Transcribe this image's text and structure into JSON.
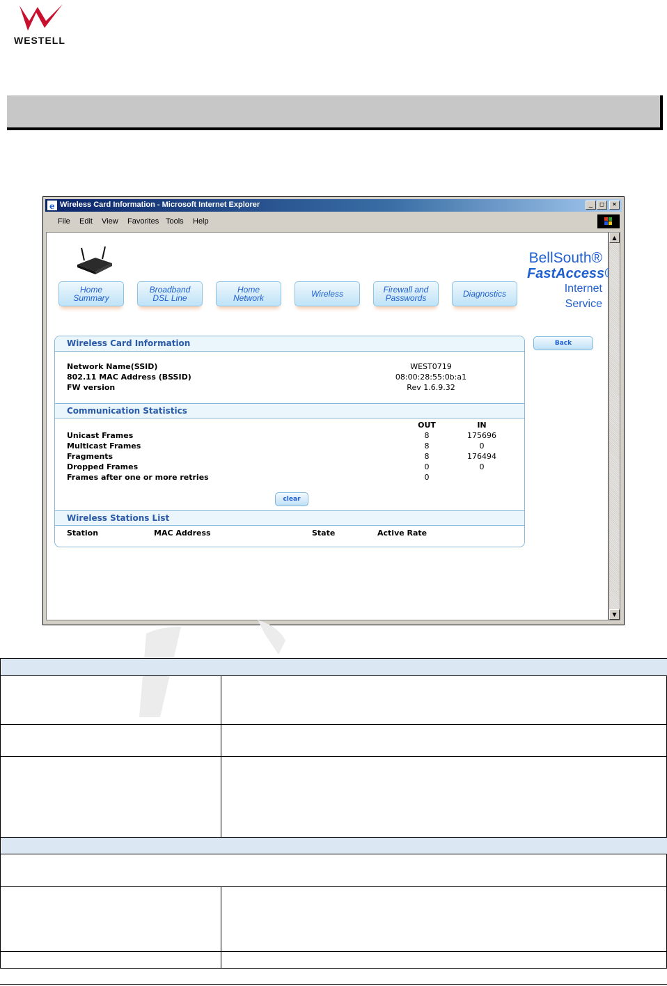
{
  "doc": {
    "logo_text": "WESTELL"
  },
  "window": {
    "title": "Wireless Card Information - Microsoft Internet Explorer",
    "buttons": [
      "_",
      "□",
      "×"
    ],
    "menu": [
      "File",
      "Edit",
      "View",
      "Favorites",
      "Tools",
      "Help"
    ]
  },
  "nav": [
    {
      "label": "Home\nSummary"
    },
    {
      "label": "Broadband\nDSL Line"
    },
    {
      "label": "Home\nNetwork"
    },
    {
      "label": "Wireless"
    },
    {
      "label": "Firewall and\nPasswords"
    },
    {
      "label": "Diagnostics"
    }
  ],
  "brand": {
    "line1": "BellSouth®",
    "line2": "FastAccess®",
    "line3": "Internet Service"
  },
  "back_label": "Back",
  "card": {
    "title": "Wireless Card Information",
    "rows": [
      {
        "label": "Network Name(SSID)",
        "value": "WEST0719"
      },
      {
        "label": "802.11 MAC Address (BSSID)",
        "value": "08:00:28:55:0b:a1"
      },
      {
        "label": "FW version",
        "value": "Rev 1.6.9.32"
      }
    ]
  },
  "stats": {
    "title": "Communication Statistics",
    "col_out": "OUT",
    "col_in": "IN",
    "rows": [
      {
        "label": "Unicast Frames",
        "out": "8",
        "in": "175696"
      },
      {
        "label": "Multicast Frames",
        "out": "8",
        "in": "0"
      },
      {
        "label": "Fragments",
        "out": "8",
        "in": "176494"
      },
      {
        "label": "Dropped Frames",
        "out": "0",
        "in": "0"
      },
      {
        "label": "Frames after one or more retries",
        "out": "0",
        "in": ""
      }
    ],
    "clear_label": "clear"
  },
  "stations": {
    "title": "Wireless Stations List",
    "columns": [
      "Station",
      "MAC Address",
      "State",
      "Active Rate"
    ]
  },
  "colors": {
    "accent": "#1f5fd0",
    "header_bg": "#eaf5fc",
    "banner": "#c7c7c7",
    "title_bar": "#0a246a"
  }
}
